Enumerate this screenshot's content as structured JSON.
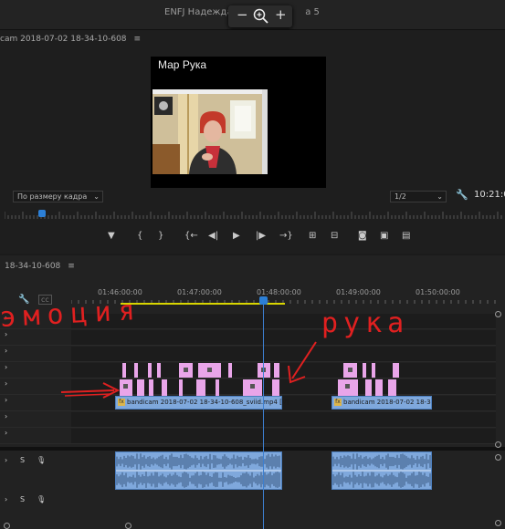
{
  "window": {
    "title": "ENFJ Надежда М",
    "title_suffix": "а 5"
  },
  "zoom_pill": {
    "minus": "−",
    "zoom_icon": "zoom-in",
    "plus": "+"
  },
  "program_monitor": {
    "sequence_name": "cam 2018-07-02 18-34-10-608",
    "menu": "≡",
    "video_title": "Мар Рука",
    "fit_select": "По размеру кадра",
    "resolution_select": "1/2",
    "timecode": "10:21:0",
    "transport": [
      {
        "name": "add-marker",
        "glyph": "▼"
      },
      {
        "name": "mark-in",
        "glyph": "{"
      },
      {
        "name": "mark-out",
        "glyph": "}"
      },
      {
        "name": "go-to-in",
        "glyph": "{←"
      },
      {
        "name": "step-back",
        "glyph": "◀|"
      },
      {
        "name": "play",
        "glyph": "▶"
      },
      {
        "name": "step-forward",
        "glyph": "|▶"
      },
      {
        "name": "go-to-out",
        "glyph": "→}"
      },
      {
        "name": "lift",
        "glyph": "⊞"
      },
      {
        "name": "extract",
        "glyph": "⊟"
      },
      {
        "name": "export-frame",
        "glyph": "◙"
      },
      {
        "name": "insert",
        "glyph": "▣"
      },
      {
        "name": "overwrite",
        "glyph": "▤"
      }
    ]
  },
  "timeline": {
    "sequence_name": "18-34-10-608",
    "menu": "≡",
    "ruler_labels": [
      "01:46:00:00",
      "01:47:00:00",
      "01:48:00:00",
      "01:49:00:00",
      "01:50:00:00"
    ],
    "clips": [
      {
        "label": "bandicam 2018-07-02 18-34-10-608_sviid.mp4 [V]"
      },
      {
        "label": "bandicam 2018-07-02 18-34"
      }
    ],
    "audio_tracks": [
      {
        "letter": "S"
      },
      {
        "letter": "S"
      }
    ]
  },
  "annotations": {
    "emotions": "эмоция",
    "hand": "рука"
  },
  "colors": {
    "annotation": "#e02020",
    "video_clip": "#7fa8dc",
    "marker_clip": "#e9a5e9",
    "playhead": "#3d7fd0",
    "work_area": "#d8d500"
  }
}
